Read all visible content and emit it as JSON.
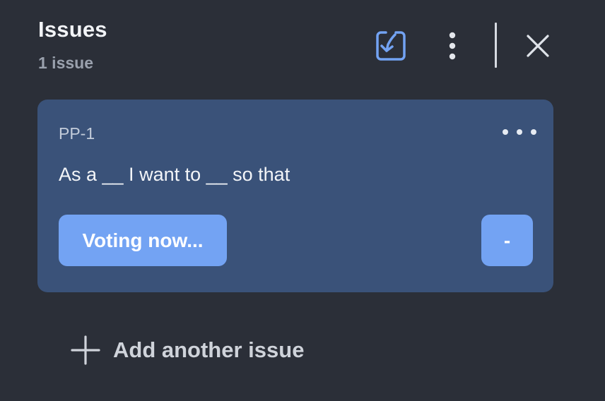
{
  "header": {
    "title": "Issues",
    "count": "1 issue",
    "icons": {
      "import": "import-icon",
      "more": "more-vertical-icon",
      "close": "close-icon"
    }
  },
  "issues": [
    {
      "key": "PP-1",
      "title": "As a __ I want to __ so that",
      "status_button": "Voting now...",
      "estimate": "-"
    }
  ],
  "footer": {
    "add_label": "Add another issue"
  },
  "colors": {
    "background": "#2b2f38",
    "card": "#3a5279",
    "accent": "#73a3f3"
  }
}
